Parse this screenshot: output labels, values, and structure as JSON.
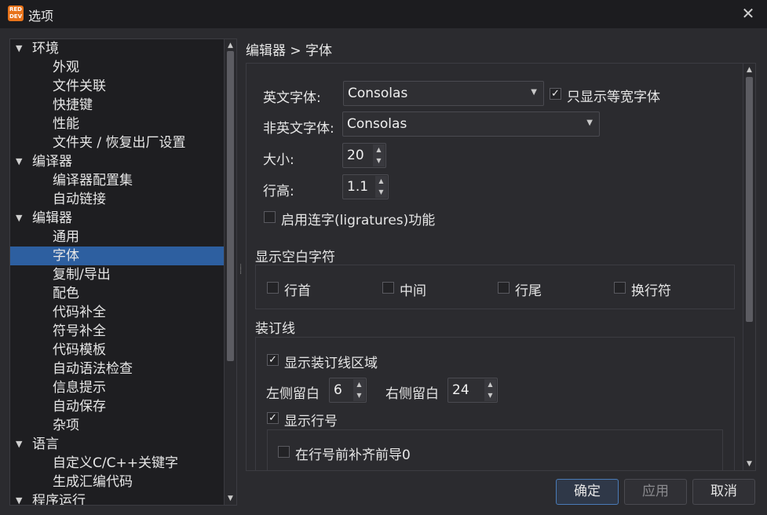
{
  "window": {
    "title": "选项",
    "icon_label": "RED DEV"
  },
  "tree": {
    "items": [
      {
        "label": "环境",
        "root": true
      },
      {
        "label": "外观"
      },
      {
        "label": "文件关联"
      },
      {
        "label": "快捷键"
      },
      {
        "label": "性能"
      },
      {
        "label": "文件夹 / 恢复出厂设置"
      },
      {
        "label": "编译器",
        "root": true
      },
      {
        "label": "编译器配置集"
      },
      {
        "label": "自动链接"
      },
      {
        "label": "编辑器",
        "root": true
      },
      {
        "label": "通用"
      },
      {
        "label": "字体",
        "selected": true
      },
      {
        "label": "复制/导出"
      },
      {
        "label": "配色"
      },
      {
        "label": "代码补全"
      },
      {
        "label": "符号补全"
      },
      {
        "label": "代码模板"
      },
      {
        "label": "自动语法检查"
      },
      {
        "label": "信息提示"
      },
      {
        "label": "自动保存"
      },
      {
        "label": "杂项"
      },
      {
        "label": "语言",
        "root": true
      },
      {
        "label": "自定义C/C++关键字"
      },
      {
        "label": "生成汇编代码"
      },
      {
        "label": "程序运行",
        "root": true
      }
    ]
  },
  "breadcrumb": "编辑器 > 字体",
  "font": {
    "english_label": "英文字体:",
    "english_value": "Consolas",
    "monospace_only_label": "只显示等宽字体",
    "monospace_only": true,
    "non_english_label": "非英文字体:",
    "non_english_value": "Consolas",
    "size_label": "大小:",
    "size_value": "20",
    "line_height_label": "行高:",
    "line_height_value": "1.1",
    "ligatures_label": "启用连字(ligratures)功能",
    "ligatures": false
  },
  "whitespace": {
    "title": "显示空白字符",
    "options": [
      {
        "label": "行首",
        "checked": false
      },
      {
        "label": "中间",
        "checked": false
      },
      {
        "label": "行尾",
        "checked": false
      },
      {
        "label": "换行符",
        "checked": false
      }
    ]
  },
  "gutter": {
    "title": "装订线",
    "show_gutter_label": "显示装订线区域",
    "show_gutter": true,
    "left_padding_label": "左侧留白",
    "left_padding_value": "6",
    "right_padding_label": "右侧留白",
    "right_padding_value": "24",
    "show_line_numbers_label": "显示行号",
    "show_line_numbers": true,
    "pad_zeros_label": "在行号前补齐前导0",
    "pad_zeros": false
  },
  "buttons": {
    "ok": "确定",
    "apply": "应用",
    "cancel": "取消"
  },
  "colors": {
    "selection": "#2d5fa0",
    "accent": "#4a7bb7"
  }
}
